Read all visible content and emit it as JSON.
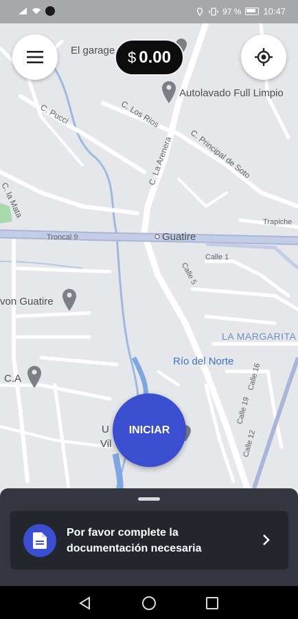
{
  "status_bar": {
    "battery": "97 %",
    "time": "10:47"
  },
  "map": {
    "labels": {
      "el_garage": "El garage",
      "autolavado": "Autolavado Full Limpio",
      "c_pucci": "C. Pucci",
      "c_los_rios": "C. Los Rios",
      "c_la_arenera": "C. La Arenera",
      "c_principal_de_soto": "C. Principal de Soto",
      "c_la_mata": "C. la Mata",
      "trapiche": "Trapiche",
      "troncal_9": "Troncal 9",
      "guatire": "Guatire",
      "calle_1": "Calle 1",
      "calle_5": "Calle 5",
      "avon_guatire": "von Guatire",
      "la_margarita": "LA MARGARITA",
      "rio_del_norte": "Río del Norte",
      "calle_16": "Calle 16",
      "calle_19": "Calle 19",
      "calle_12": "Calle 12",
      "ca": "C.A",
      "u_label": "U",
      "vil_label": "Vil"
    }
  },
  "balance": {
    "currency": "$",
    "amount": "0.00"
  },
  "start_button": {
    "label": "INICIAR"
  },
  "bottom_sheet": {
    "message": "Por favor complete la documentación necesaria"
  },
  "colors": {
    "accent": "#3c4ed0",
    "map_bg": "#e5e7eb",
    "sheet_bg": "#33363f",
    "card_bg": "#24262d"
  },
  "icons": {
    "menu": "hamburger-icon",
    "locate": "crosshair-icon",
    "document": "document-icon",
    "chevron": "chevron-right-icon",
    "nav_back": "triangle-back-icon",
    "nav_home": "circle-home-icon",
    "nav_recents": "square-recents-icon"
  }
}
